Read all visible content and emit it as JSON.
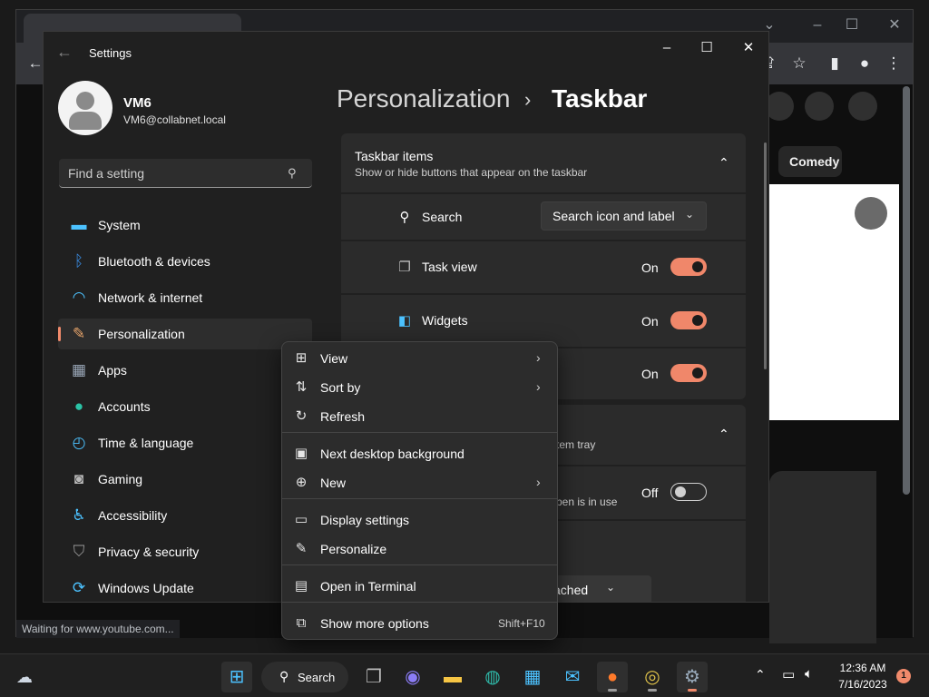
{
  "browser": {
    "status_text": "Waiting for www.youtube.com...",
    "chip_comedy": "Comedy"
  },
  "settings": {
    "app_title": "Settings",
    "user": {
      "name": "VM6",
      "email": "VM6@collabnet.local"
    },
    "search": {
      "placeholder": "Find a setting"
    },
    "nav": [
      {
        "label": "System",
        "icon": "monitor-icon",
        "color": "#4cc2ff"
      },
      {
        "label": "Bluetooth & devices",
        "icon": "bluetooth-icon",
        "color": "#3a8ee6"
      },
      {
        "label": "Network & internet",
        "icon": "wifi-icon",
        "color": "#4cc2ff"
      },
      {
        "label": "Personalization",
        "icon": "brush-icon",
        "color": "#e8a56b",
        "selected": true
      },
      {
        "label": "Apps",
        "icon": "apps-icon",
        "color": "#9aa7b8"
      },
      {
        "label": "Accounts",
        "icon": "person-icon",
        "color": "#2bc3a6"
      },
      {
        "label": "Time & language",
        "icon": "globe-clock-icon",
        "color": "#4cc2ff"
      },
      {
        "label": "Gaming",
        "icon": "gamepad-icon",
        "color": "#b8b8b8"
      },
      {
        "label": "Accessibility",
        "icon": "accessibility-icon",
        "color": "#4cc2ff"
      },
      {
        "label": "Privacy & security",
        "icon": "shield-icon",
        "color": "#9a9a9a"
      },
      {
        "label": "Windows Update",
        "icon": "update-icon",
        "color": "#4cc2ff"
      }
    ],
    "breadcrumb": {
      "parent": "Personalization",
      "separator": "›",
      "current": "Taskbar"
    },
    "taskbar_items": {
      "title": "Taskbar items",
      "subtitle": "Show or hide buttons that appear on the taskbar",
      "search": {
        "label": "Search",
        "value": "Search icon and label"
      },
      "task_view": {
        "label": "Task view",
        "state": "On"
      },
      "widgets": {
        "label": "Widgets",
        "state": "On"
      },
      "chat": {
        "state": "On"
      }
    },
    "system_tray": {
      "subtitle_partial": "tem tray",
      "row1": {
        "text_partial": "pen is in use",
        "state": "Off"
      },
      "row2": {
        "value_partial": "ached"
      }
    }
  },
  "context_menu": {
    "items": [
      {
        "label": "View",
        "icon": "grid-icon",
        "submenu": true
      },
      {
        "label": "Sort by",
        "icon": "sort-icon",
        "submenu": true
      },
      {
        "label": "Refresh",
        "icon": "refresh-icon"
      },
      {
        "label": "Next desktop background",
        "icon": "next-background-icon"
      },
      {
        "label": "New",
        "icon": "plus-circle-icon",
        "submenu": true
      },
      {
        "label": "Display settings",
        "icon": "display-icon"
      },
      {
        "label": "Personalize",
        "icon": "pen-icon"
      },
      {
        "label": "Open in Terminal",
        "icon": "terminal-icon"
      },
      {
        "label": "Show more options",
        "icon": "more-options-icon",
        "shortcut": "Shift+F10"
      }
    ]
  },
  "taskbar": {
    "search_label": "Search",
    "time": "12:36 AM",
    "date": "7/16/2023",
    "notification_count": "1",
    "accent": "#f08a6b"
  }
}
